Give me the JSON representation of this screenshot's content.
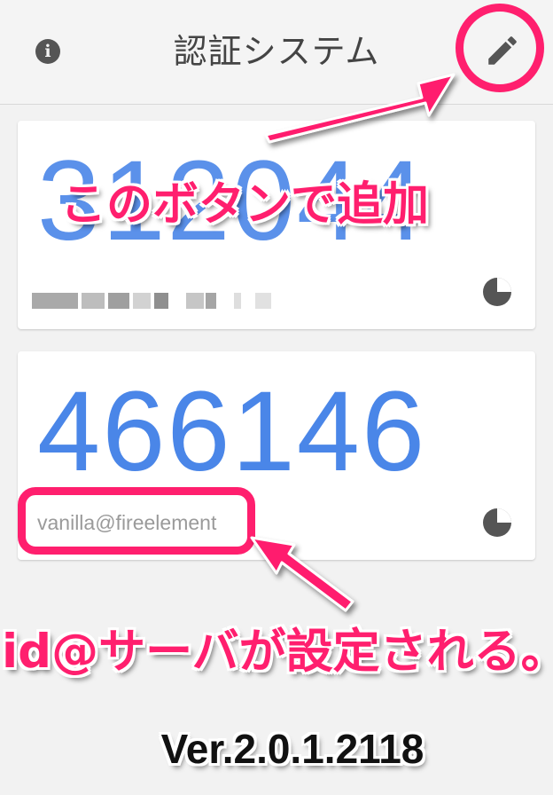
{
  "header": {
    "title": "認証システム",
    "info_icon": "info-icon",
    "edit_icon": "pencil-icon"
  },
  "accounts": [
    {
      "code": "312044",
      "account": "",
      "timer_icon": "pie-timer-icon",
      "name_blurred": true
    },
    {
      "code": "466146",
      "account": "vanilla@fireelement",
      "timer_icon": "pie-timer-icon",
      "name_blurred": false
    }
  ],
  "annotations": {
    "edit_hint": "このボタンで追加",
    "account_hint": "id@サーバが設定される。"
  },
  "footer": {
    "version": "Ver.2.0.1.2118"
  },
  "colors": {
    "accent": "#ff1f6e",
    "code": "#4a86e8",
    "background": "#f2f2f2"
  }
}
